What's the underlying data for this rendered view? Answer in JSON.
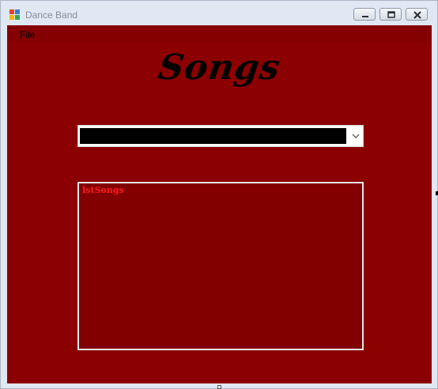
{
  "window": {
    "title": "Dance Band",
    "icon": "app-window-icon"
  },
  "caption_buttons": {
    "minimize_icon": "minimize-icon",
    "maximize_icon": "maximize-icon",
    "close_icon": "close-icon"
  },
  "menu": {
    "items": [
      {
        "label": "File"
      }
    ]
  },
  "main": {
    "heading": "Songs",
    "dropdown": {
      "selected_value": "",
      "arrow_icon": "chevron-down-icon"
    },
    "list": {
      "name_label": "lstSongs",
      "items": []
    }
  },
  "colors": {
    "form_background": "#8b0000",
    "listbox_background": "#820000",
    "listbox_label": "#ff1a1a",
    "heading": "#000000"
  }
}
